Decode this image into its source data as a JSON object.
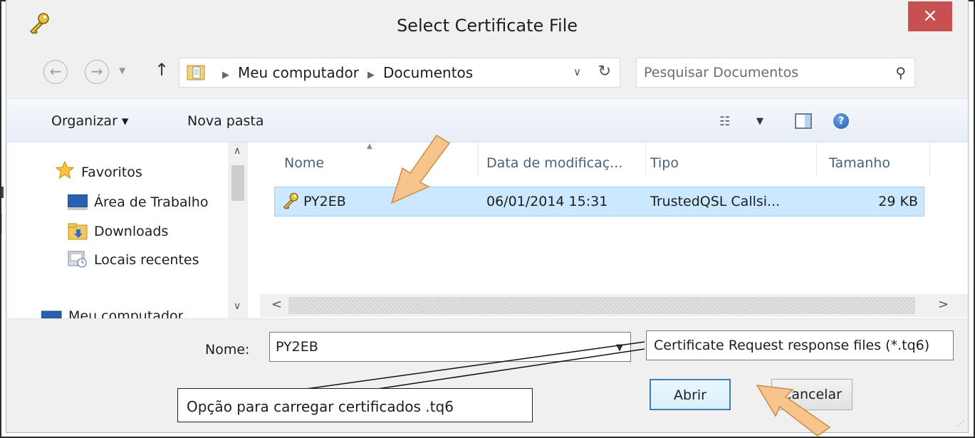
{
  "dialog": {
    "title": "Select Certificate File",
    "close_label": "×"
  },
  "nav": {
    "back_glyph": "←",
    "forward_glyph": "→",
    "up_glyph": "↑",
    "breadcrumb": [
      "Meu computador",
      "Documentos"
    ],
    "breadcrumb_sep": "▶",
    "dropdown_glyph": "∨",
    "refresh_glyph": "↻",
    "search_placeholder": "Pesquisar Documentos",
    "search_glyph": "⚲"
  },
  "toolbar": {
    "organize_label": "Organizar ▾",
    "new_folder_label": "Nova pasta",
    "views_glyph": "☷",
    "views_drop_glyph": "▼",
    "help_glyph": "?"
  },
  "sidebar": {
    "items": [
      {
        "label": "Favoritos",
        "icon": "star-icon"
      },
      {
        "label": "Área de Trabalho",
        "icon": "desktop-icon"
      },
      {
        "label": "Downloads",
        "icon": "downloads-folder-icon"
      },
      {
        "label": "Locais recentes",
        "icon": "recent-places-icon"
      },
      {
        "label": "Meu computador",
        "icon": "computer-icon"
      }
    ],
    "scroll_up": "∧",
    "scroll_down": "∨"
  },
  "filelist": {
    "columns": [
      "Nome",
      "Data de modificaç...",
      "Tipo",
      "Tamanho"
    ],
    "rows": [
      {
        "name": "PY2EB",
        "date": "06/01/2014 15:31",
        "type": "TrustedQSL Callsi...",
        "size": "29 KB",
        "icon": "key-icon"
      }
    ],
    "scroll_left": "<",
    "scroll_right": ">"
  },
  "bottom": {
    "filename_label": "Nome:",
    "filename_value": "PY2EB",
    "filter_value": "Certificate Request response files (*.tq6)",
    "open_label": "Abrir",
    "cancel_label": "Cancelar"
  },
  "annotation": {
    "text": "Opção para carregar certificados .tq6"
  },
  "colors": {
    "close_bg": "#c75050",
    "selection_bg": "#cce8ff",
    "arrow_fill": "#f7c48c",
    "arrow_stroke": "#c98a4a"
  }
}
